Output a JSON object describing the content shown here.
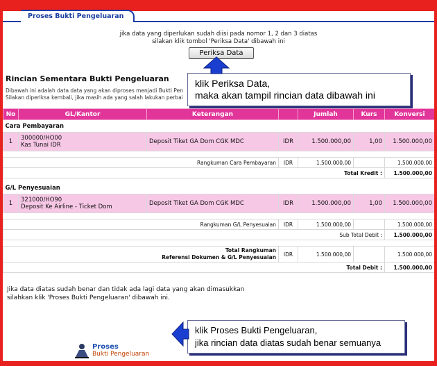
{
  "tab_title": "Proses Bukti Pengeluaran",
  "instruction_line1": "jika data yang diperlukan sudah diisi pada nomor 1, 2 dan 3 diatas",
  "instruction_line2": "silakan klik tombol 'Periksa Data' dibawah ini",
  "periksa_button": "Periksa Data",
  "section_title": "Rincian Sementara Bukti Pengeluaran",
  "desc_line1": "Dibawah ini adalah data data yang akan diproses menjadi Bukti Pen",
  "desc_line2": "Silakan diperiksa kembali, jika masih ada yang salah lakukan perbai",
  "headers": [
    "No",
    "GL/Kantor",
    "Keterangan",
    "",
    "Jumlah",
    "Kurs",
    "Konversi"
  ],
  "cara_pembayaran": {
    "title": "Cara Pembayaran",
    "row": {
      "no": "1",
      "gl_line1": "300000/HO00",
      "gl_line2": "Kas Tunai IDR",
      "keterangan": "Deposit Tiket GA Dom CGK MDC",
      "currency": "IDR",
      "jumlah": "1.500.000,00",
      "kurs": "1,00",
      "konversi": "1.500.000,00"
    },
    "rangkuman_label": "Rangkuman Cara Pembayaran",
    "rangkuman_currency": "IDR",
    "rangkuman_jumlah": "1.500.000,00",
    "rangkuman_konversi": "1.500.000,00",
    "total_label": "Total Kredit :",
    "total_value": "1.500.000,00"
  },
  "gl_penyesuaian": {
    "title": "G/L Penyesuaian",
    "row": {
      "no": "1",
      "gl_line1": "321000/HO90",
      "gl_line2": "Deposit Ke Airline - Ticket Dom",
      "keterangan": "Deposit Tiket GA Dom CGK MDC",
      "currency": "IDR",
      "jumlah": "1.500.000,00",
      "kurs": "1,00",
      "konversi": "1.500.000,00"
    },
    "rangkuman_label": "Rangkuman G/L Penyesuaian",
    "rangkuman_currency": "IDR",
    "rangkuman_jumlah": "1.500.000,00",
    "rangkuman_konversi": "1.500.000,00",
    "subtotal_label": "Sub Total Debit :",
    "subtotal_value": "1.500.000,00"
  },
  "total_rangkuman": {
    "label_line1": "Total Rangkuman",
    "label_line2": "Referensi Dokumen & G/L Penyesuaian",
    "currency": "IDR",
    "jumlah": "1.500.000,00",
    "konversi": "1.500.000,00",
    "total_debit_label": "Total Debit :",
    "total_debit_value": "1.500.000,00"
  },
  "closing_line1": "Jika data diatas sudah benar dan tidak ada lagi data yang akan dimasukkan",
  "closing_line2": "silahkan klik 'Proses Bukti Pengeluaran' dibawah ini.",
  "proses_button": {
    "line1": "Proses",
    "line2": "Bukti Pengeluaran"
  },
  "callout1": {
    "line1": "klik Periksa Data,",
    "line2": "maka akan tampil rincian data dibawah ini"
  },
  "callout2": {
    "line1": "klik Proses Bukti Pengeluaran,",
    "line2": "jika rincian data diatas sudah benar semuanya"
  },
  "colors": {
    "background_red": "#e8201e",
    "header_magenta": "#e2359a",
    "row_pink": "#f7c8e6",
    "arrow_blue": "#1a3fd0"
  }
}
